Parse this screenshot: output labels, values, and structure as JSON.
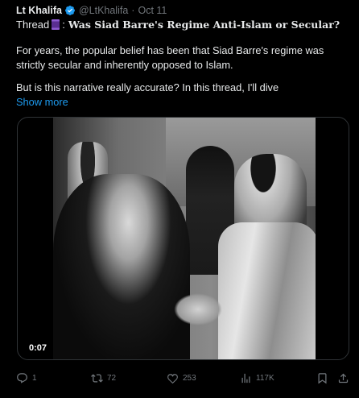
{
  "author": {
    "name": "Lt Khalifa",
    "handle": "@LtKhalifa",
    "separator": "·",
    "date": "Oct 11"
  },
  "more_label": "···",
  "tweet": {
    "thread_prefix": "Thread",
    "thread_separator": ":",
    "title": "Was Siad Barre's Regime Anti-Islam or Secular?",
    "paragraph1": "For years, the popular belief has been that Siad Barre's regime was strictly secular and inherently opposed to Islam.",
    "paragraph2": "But is this narrative really accurate? In this thread, I'll dive",
    "show_more": "Show more"
  },
  "media": {
    "timestamp": "0:07"
  },
  "actions": {
    "replies": "1",
    "retweets": "72",
    "likes": "253",
    "views": "117K"
  },
  "colors": {
    "background": "#000000",
    "text": "#e7e9ea",
    "muted": "#71767b",
    "link": "#1d9bf0",
    "verified": "#1d9bf0"
  }
}
